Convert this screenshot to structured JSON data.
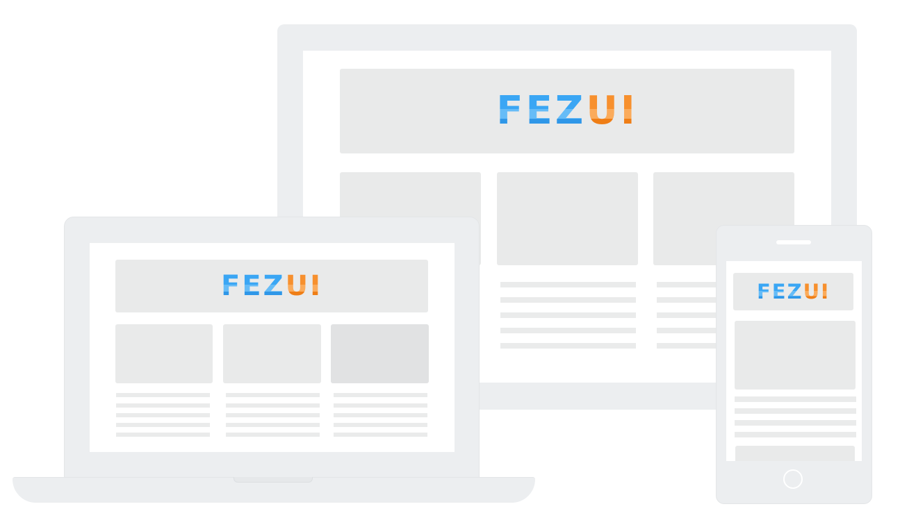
{
  "brand": {
    "logo_part_1": "FEZ",
    "logo_part_2": "UI",
    "colors": {
      "blue": "#3aa6f4",
      "orange": "#f7902e",
      "frame": "#eceef0",
      "placeholder": "#e9eaea"
    }
  },
  "devices": {
    "monitor": {
      "icon": "desktop-monitor"
    },
    "laptop": {
      "icon": "laptop"
    },
    "phone": {
      "icon": "smartphone",
      "home_button_icon": "circle-icon"
    }
  }
}
